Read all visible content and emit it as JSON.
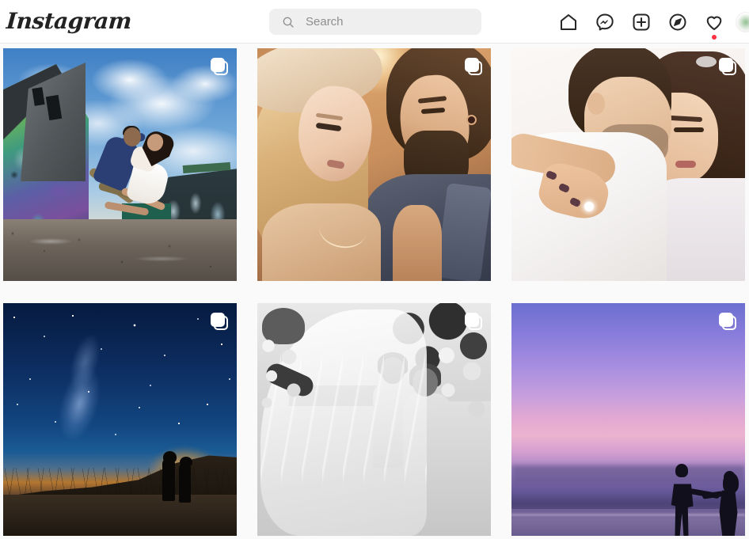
{
  "app": {
    "name": "Instagram",
    "logo_text": "Instagram"
  },
  "header": {
    "search": {
      "placeholder": "Search",
      "value": "",
      "icon": "search-icon"
    },
    "nav": [
      {
        "id": "home",
        "label": "Home",
        "icon": "home-icon",
        "badge": false
      },
      {
        "id": "messages",
        "label": "Messenger",
        "icon": "messenger-icon",
        "badge": false
      },
      {
        "id": "new-post",
        "label": "New post",
        "icon": "plus-square-icon",
        "badge": false
      },
      {
        "id": "explore",
        "label": "Explore",
        "icon": "compass-icon",
        "badge": false
      },
      {
        "id": "activity",
        "label": "Activity",
        "icon": "heart-icon",
        "badge": true
      }
    ],
    "profile": {
      "label": "Profile",
      "icon": "avatar"
    }
  },
  "colors": {
    "page_background": "#fafafa",
    "header_background": "#ffffff",
    "header_border": "#e8e8e8",
    "search_background": "#efefef",
    "text_primary": "#262626",
    "text_secondary": "#8e8e8e",
    "notification_dot": "#ff3040"
  },
  "grid": {
    "columns": 3,
    "posts": [
      {
        "id": "post-1",
        "alt": "Couple dancing and kissing in a graffiti alley under a cloudy blue sky",
        "scene": "graffiti-alley",
        "multi_post": true,
        "badge_icon": "carousel-icon"
      },
      {
        "id": "post-2",
        "alt": "Golden hour portrait of a blonde woman in a hat and a bearded man in a denim shirt",
        "scene": "golden-hour-portrait",
        "multi_post": true,
        "badge_icon": "carousel-icon"
      },
      {
        "id": "post-3",
        "alt": "Bright engagement photo of a couple embracing, engagement ring visible",
        "scene": "bright-embrace",
        "multi_post": true,
        "badge_icon": "carousel-icon"
      },
      {
        "id": "post-4",
        "alt": "Milky Way night sky over beach dunes with a silhouetted couple in warm light",
        "scene": "milky-way-dunes",
        "multi_post": true,
        "badge_icon": "carousel-icon"
      },
      {
        "id": "post-5",
        "alt": "Black and white wedding photo of a bride with a flowing veil and bridesmaids",
        "scene": "bw-wedding",
        "multi_post": true,
        "badge_icon": "carousel-icon"
      },
      {
        "id": "post-6",
        "alt": "Purple and pink twilight sky over the sea with a silhouetted couple holding hands",
        "scene": "purple-twilight",
        "multi_post": true,
        "badge_icon": "carousel-icon"
      }
    ]
  }
}
